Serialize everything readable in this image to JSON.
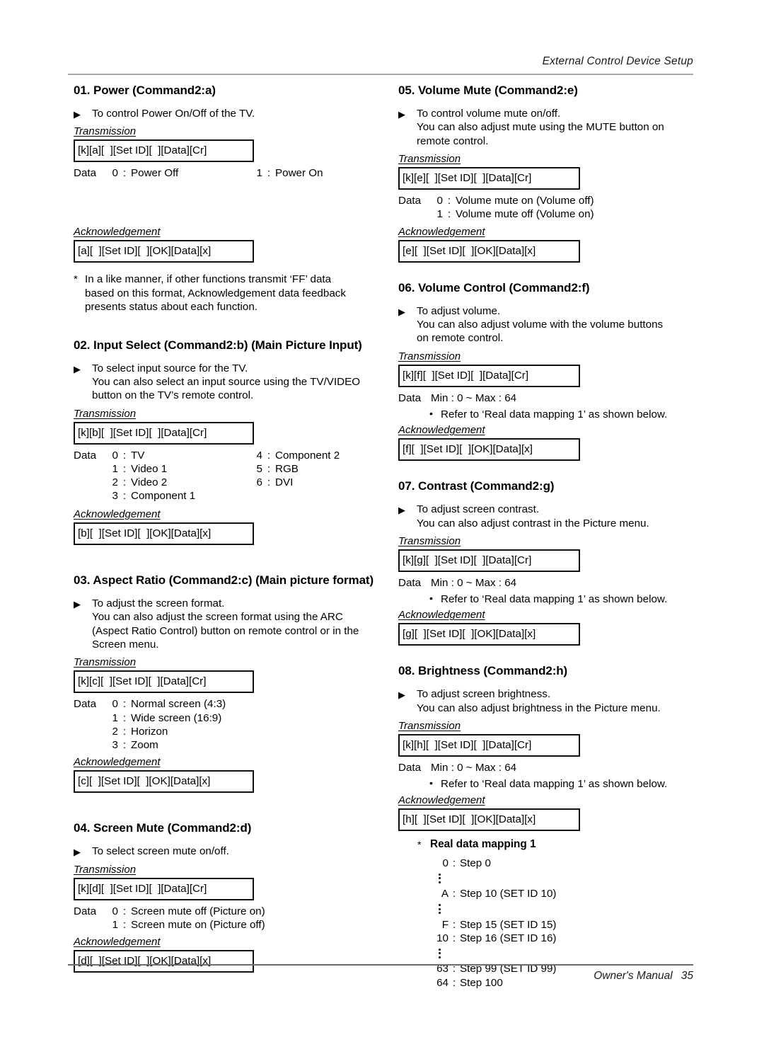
{
  "header": {
    "title": "External Control Device Setup"
  },
  "footer": {
    "manual": "Owner's Manual",
    "page": "35"
  },
  "labels": {
    "transmission": "Transmission",
    "acknowledgement": "Acknowledgement",
    "data": "Data",
    "colon": ":",
    "arrow_icon": "▶",
    "star": "*",
    "bullet": "•"
  },
  "sections": [
    {
      "title": "01. Power (Command2:a)",
      "desc": [
        "To control Power On/Off of the TV."
      ],
      "transmission": "[k][a][  ][Set ID][  ][Data][Cr]",
      "data_rows": [
        {
          "key": "0",
          "value": "Power Off"
        }
      ],
      "data_rows_col2": [
        {
          "key": "1",
          "value": "Power On"
        }
      ],
      "ack": "[a][  ][Set ID][  ][OK][Data][x]",
      "note": [
        "In a like manner, if other functions transmit ‘FF’ data",
        "based on this format, Acknowledgement data feedback",
        "presents status about each function."
      ]
    },
    {
      "title": "02. Input Select (Command2:b) (Main Picture Input)",
      "desc": [
        "To select input source for the TV.",
        "You can also select an input source using the TV/VIDEO",
        "button on the TV’s remote control."
      ],
      "transmission": "[k][b][  ][Set ID][  ][Data][Cr]",
      "data_rows": [
        {
          "key": "0",
          "value": "TV"
        },
        {
          "key": "1",
          "value": "Video 1"
        },
        {
          "key": "2",
          "value": "Video 2"
        },
        {
          "key": "3",
          "value": "Component 1"
        }
      ],
      "data_rows_col2": [
        {
          "key": "4",
          "value": "Component 2"
        },
        {
          "key": "5",
          "value": "RGB"
        },
        {
          "key": "6",
          "value": "DVI"
        }
      ],
      "ack": "[b][  ][Set ID][  ][OK][Data][x]"
    },
    {
      "title": "03. Aspect Ratio (Command2:c) (Main picture format)",
      "desc": [
        "To adjust the screen format.",
        "You can also adjust the screen format using the ARC",
        "(Aspect Ratio Control) button on remote control or in the",
        "Screen menu."
      ],
      "transmission": "[k][c][  ][Set ID][  ][Data][Cr]",
      "data_rows": [
        {
          "key": "0",
          "value": "Normal screen (4:3)"
        },
        {
          "key": "1",
          "value": "Wide screen (16:9)"
        },
        {
          "key": "2",
          "value": "Horizon"
        },
        {
          "key": "3",
          "value": "Zoom"
        }
      ],
      "ack": "[c][  ][Set ID][  ][OK][Data][x]"
    },
    {
      "title": "04. Screen Mute (Command2:d)",
      "desc": [
        "To select screen mute on/off."
      ],
      "transmission": "[k][d][  ][Set ID][  ][Data][Cr]",
      "data_rows": [
        {
          "key": "0",
          "value": "Screen mute off (Picture on)"
        },
        {
          "key": "1",
          "value": "Screen mute on (Picture off)"
        }
      ],
      "ack": "[d][  ][Set ID][  ][OK][Data][x]"
    },
    {
      "title": "05. Volume Mute (Command2:e)",
      "desc": [
        "To control volume mute on/off.",
        "You can also adjust mute using the MUTE button on",
        "remote control."
      ],
      "transmission": "[k][e][  ][Set ID][  ][Data][Cr]",
      "data_rows": [
        {
          "key": "0",
          "value": "Volume mute on (Volume off)"
        },
        {
          "key": "1",
          "value": "Volume mute off (Volume on)"
        }
      ],
      "ack": "[e][  ][Set ID][  ][OK][Data][x]"
    },
    {
      "title": "06. Volume Control (Command2:f)",
      "desc": [
        "To adjust volume.",
        "You can also adjust volume with the volume buttons",
        "on remote control."
      ],
      "transmission": "[k][f][  ][Set ID][  ][Data][Cr]",
      "data_range": "Min : 0 ~ Max : 64",
      "refer": "Refer to ‘Real data mapping 1’ as shown below.",
      "ack": "[f][  ][Set ID][  ][OK][Data][x]"
    },
    {
      "title": "07. Contrast (Command2:g)",
      "desc": [
        "To adjust screen contrast.",
        "You can also adjust contrast in the Picture menu."
      ],
      "transmission": "[k][g][  ][Set ID][  ][Data][Cr]",
      "data_range": "Min : 0 ~ Max : 64",
      "refer": "Refer to ‘Real data mapping 1’ as shown below.",
      "ack": "[g][  ][Set ID][  ][OK][Data][x]"
    },
    {
      "title": "08. Brightness (Command2:h)",
      "desc": [
        "To adjust screen brightness.",
        "You can also adjust brightness in the Picture menu."
      ],
      "transmission": "[k][h][  ][Set ID][  ][Data][Cr]",
      "data_range": "Min : 0 ~ Max : 64",
      "refer": "Refer to ‘Real data mapping 1’ as shown below.",
      "ack": "[h][  ][Set ID][  ][OK][Data][x]"
    }
  ],
  "real_data_mapping": {
    "title": "Real data mapping 1",
    "rows": [
      {
        "key": "0",
        "value": "Step 0"
      },
      {
        "ellipsis": true
      },
      {
        "key": "A",
        "value": "Step 10 (SET ID 10)"
      },
      {
        "ellipsis": true
      },
      {
        "key": "F",
        "value": "Step 15 (SET ID 15)"
      },
      {
        "key": "10",
        "value": "Step 16 (SET ID 16)"
      },
      {
        "ellipsis": true
      },
      {
        "key": "63",
        "value": "Step 99 (SET ID 99)"
      },
      {
        "key": "64",
        "value": "Step 100"
      }
    ]
  }
}
